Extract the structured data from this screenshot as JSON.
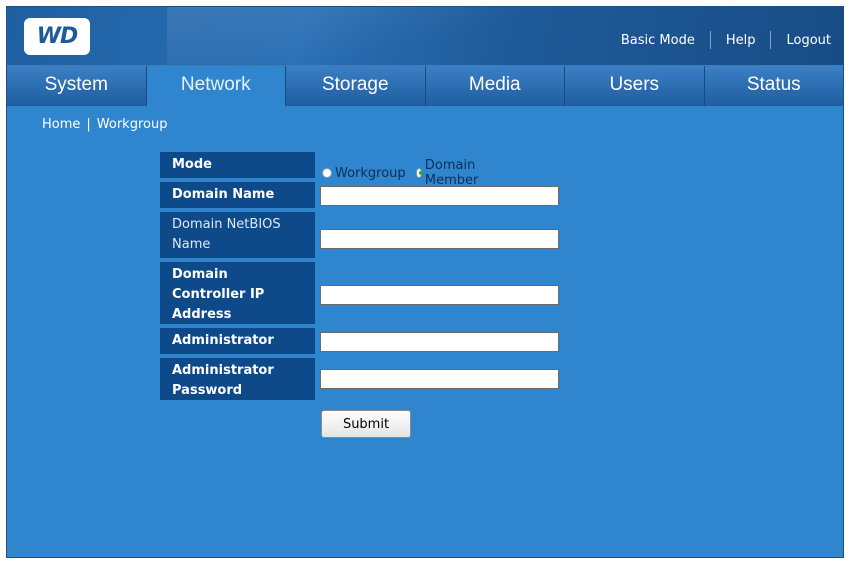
{
  "header": {
    "logo_text": "WD",
    "links": {
      "basic_mode": "Basic Mode",
      "help": "Help",
      "logout": "Logout"
    }
  },
  "nav": {
    "tabs": [
      {
        "label": "System"
      },
      {
        "label": "Network",
        "active": true
      },
      {
        "label": "Storage"
      },
      {
        "label": "Media"
      },
      {
        "label": "Users"
      },
      {
        "label": "Status"
      }
    ]
  },
  "breadcrumb": {
    "home": "Home",
    "separator": "|",
    "current": "Workgroup"
  },
  "form": {
    "mode": {
      "label": "Mode",
      "options": [
        "Workgroup",
        "Domain Member"
      ],
      "selected": "Domain Member"
    },
    "domain_name": {
      "label": "Domain Name",
      "value": ""
    },
    "domain_netbios_name": {
      "label_line1": "Domain NetBIOS",
      "label_line2": "Name",
      "value": ""
    },
    "domain_controller_ip": {
      "label_line1": "Domain",
      "label_line2": "Controller IP",
      "label_line3": "Address",
      "value": ""
    },
    "administrator": {
      "label": "Administrator",
      "value": ""
    },
    "administrator_password": {
      "label_line1": "Administrator",
      "label_line2": "Password",
      "value": ""
    },
    "submit_label": "Submit"
  },
  "colors": {
    "page_bg": "#2f86cf",
    "label_bg": "#0e4a8a",
    "nav_bg": "#1e5da0",
    "radio_checked": "#2aa82a"
  }
}
